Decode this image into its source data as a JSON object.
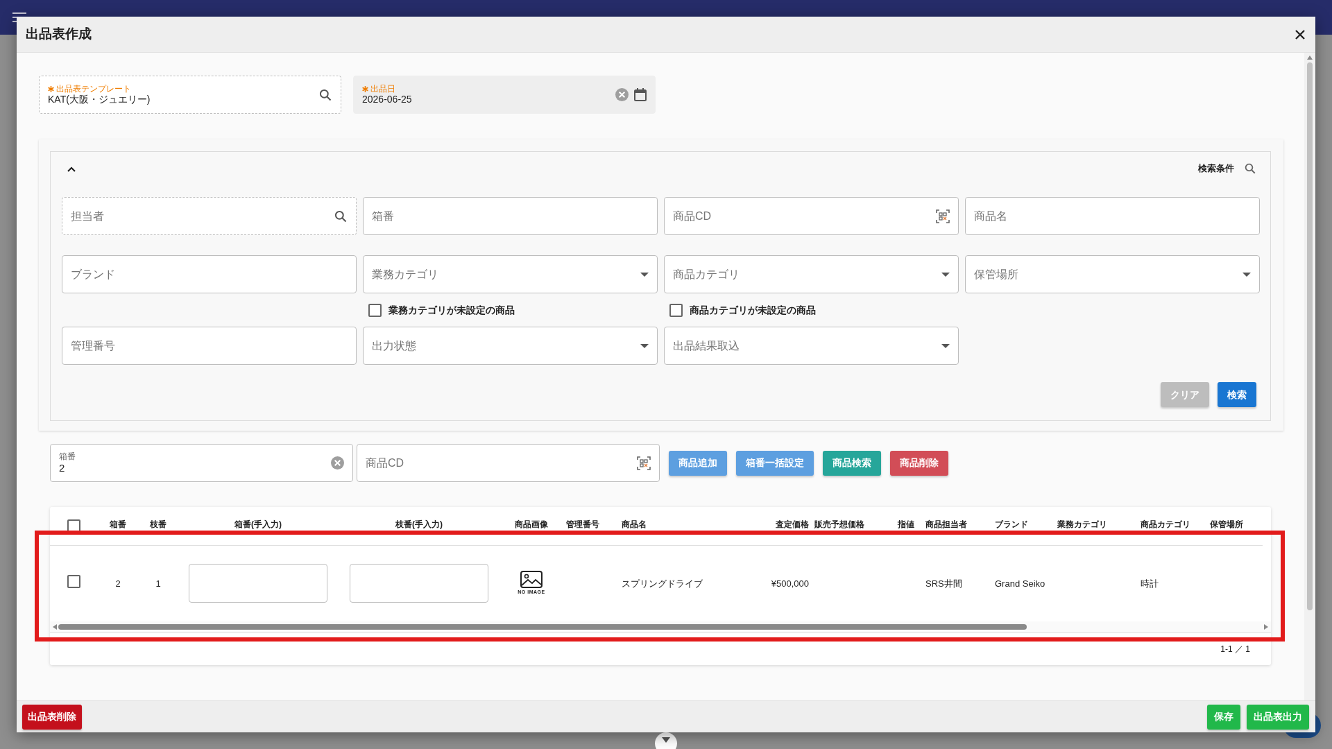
{
  "dialog": {
    "title": "出品表作成"
  },
  "header_fields": [
    {
      "kind": "lookup",
      "label": "出品表テンプレート",
      "required": true,
      "value": "KAT(大阪・ジュエリー)"
    },
    {
      "kind": "date",
      "label": "出品日",
      "required": true,
      "value": "2026-06-25"
    }
  ],
  "search_panel": {
    "expanded": true,
    "title": "検索条件",
    "fields": [
      {
        "kind": "lookup",
        "placeholder": "担当者"
      },
      {
        "kind": "text",
        "placeholder": "箱番"
      },
      {
        "kind": "scan",
        "placeholder": "商品CD"
      },
      {
        "kind": "text",
        "placeholder": "商品名"
      },
      {
        "kind": "text",
        "placeholder": "ブランド"
      },
      {
        "kind": "select",
        "placeholder": "業務カテゴリ"
      },
      {
        "kind": "select",
        "placeholder": "商品カテゴリ"
      },
      {
        "kind": "select",
        "placeholder": "保管場所"
      },
      {
        "kind": "checkbox",
        "label": "業務カテゴリが未設定の商品",
        "checked": false
      },
      {
        "kind": "checkbox",
        "label": "商品カテゴリが未設定の商品",
        "checked": false
      },
      {
        "kind": "text",
        "placeholder": "管理番号"
      },
      {
        "kind": "select",
        "placeholder": "出力状態"
      },
      {
        "kind": "select",
        "placeholder": "出品結果取込"
      }
    ],
    "buttons": [
      {
        "label": "クリア",
        "kind": "secondary"
      },
      {
        "label": "検索",
        "kind": "primary"
      }
    ]
  },
  "entry_bar": {
    "fields": [
      {
        "kind": "clearable",
        "label": "箱番",
        "value": "2"
      },
      {
        "kind": "scan",
        "placeholder": "商品CD"
      }
    ],
    "buttons": [
      {
        "label": "商品追加",
        "kind": "primary"
      },
      {
        "label": "箱番一括設定",
        "kind": "primary"
      },
      {
        "label": "商品検索",
        "kind": "success"
      },
      {
        "label": "商品削除",
        "kind": "danger"
      }
    ]
  },
  "table": {
    "all_checked": false,
    "columns": [
      {
        "kind": "checkbox"
      },
      {
        "kind": "number",
        "label": "箱番"
      },
      {
        "kind": "number",
        "label": "枝番"
      },
      {
        "kind": "input",
        "label": "箱番(手入力)"
      },
      {
        "kind": "input",
        "label": "枝番(手入力)"
      },
      {
        "kind": "image",
        "label": "商品画像"
      },
      {
        "kind": "text",
        "label": "管理番号"
      },
      {
        "kind": "text",
        "label": "商品名"
      },
      {
        "kind": "money",
        "label": "査定価格"
      },
      {
        "kind": "text",
        "label": "販売予想価格"
      },
      {
        "kind": "text",
        "label": "指値"
      },
      {
        "kind": "text",
        "label": "商品担当者"
      },
      {
        "kind": "text",
        "label": "ブランド"
      },
      {
        "kind": "text",
        "label": "業務カテゴリ"
      },
      {
        "kind": "text",
        "label": "商品カテゴリ"
      },
      {
        "kind": "text",
        "label": "保管場所"
      }
    ],
    "rows": [
      {
        "checked": false,
        "cells": [
          null,
          "2",
          "1",
          null,
          null,
          "NO IMAGE",
          null,
          "スプリングドライブ",
          "¥500,000",
          null,
          null,
          "SRS井間",
          "Grand Seiko",
          null,
          "時計",
          null
        ]
      }
    ],
    "pagination": "1-1 ／ 1"
  },
  "footer": {
    "left_buttons": [
      {
        "label": "出品表削除",
        "kind": "danger"
      }
    ],
    "right_buttons": [
      {
        "label": "保存",
        "kind": "success"
      },
      {
        "label": "出品表出力",
        "kind": "success"
      }
    ]
  }
}
